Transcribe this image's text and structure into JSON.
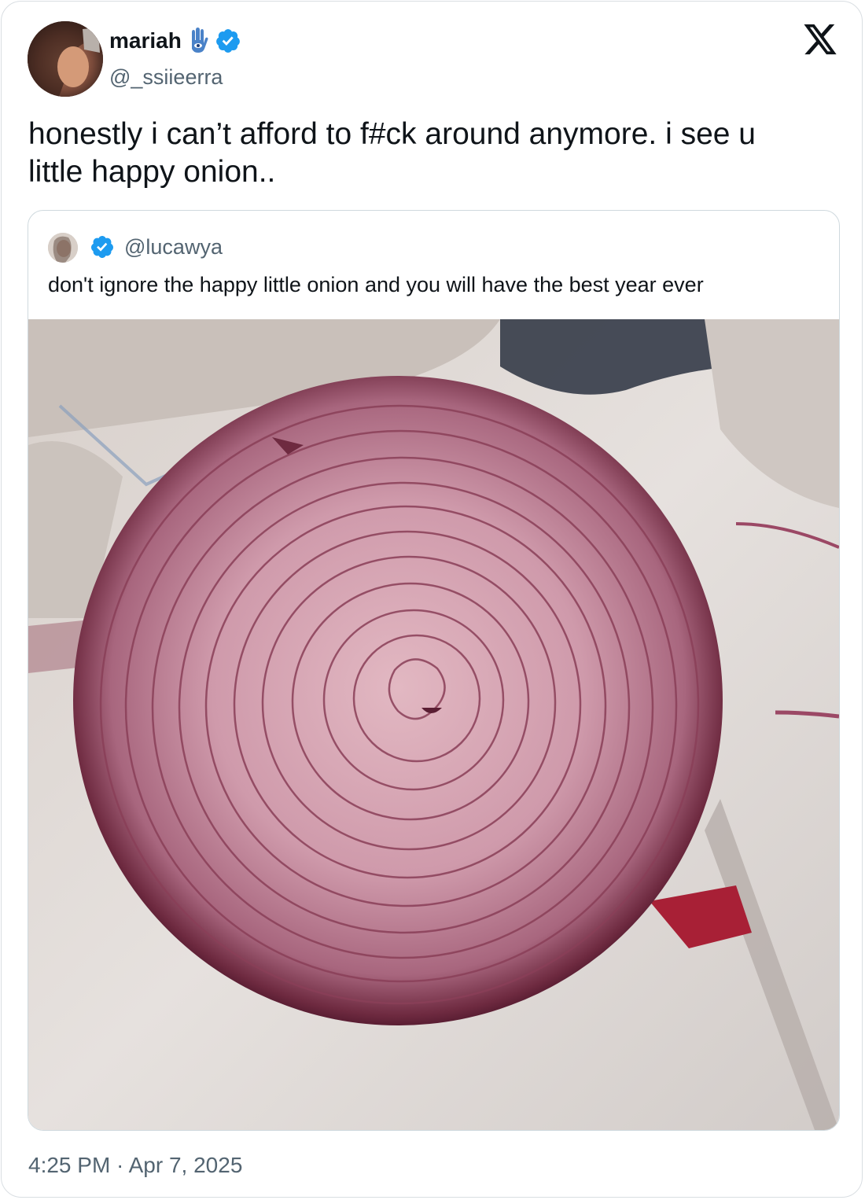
{
  "author": {
    "display_name": "mariah",
    "handle": "@_ssiieerra",
    "name_emoji_icon": "hamsa-icon",
    "verified_icon": "verified-badge-icon"
  },
  "tweet": {
    "text": "honestly i can’t afford to f#ck around anymore. i see u little happy onion.."
  },
  "quoted_tweet": {
    "handle": "@lucawya",
    "verified_icon": "verified-badge-icon",
    "text": "don't ignore the happy little onion and you will have the best year ever",
    "media": "red onion cross-section photo"
  },
  "timestamp": {
    "time": "4:25 PM",
    "separator": " · ",
    "date": "Apr 7, 2025"
  },
  "brand": {
    "logo": "x-logo-icon",
    "verified_color": "#1d9bf0",
    "secondary_text_color": "#536471"
  }
}
